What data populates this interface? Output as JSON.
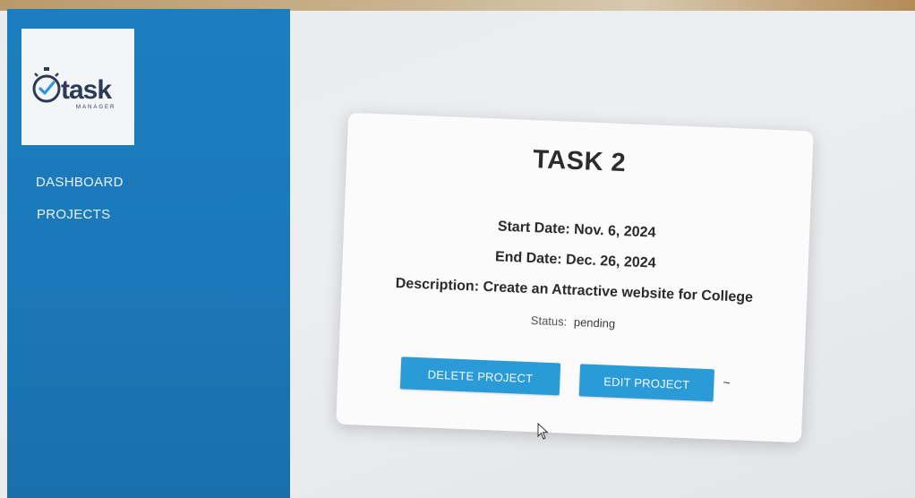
{
  "sidebar": {
    "logo": {
      "text": "task",
      "subtext": "MANAGER"
    },
    "items": [
      {
        "label": "DASHBOARD"
      },
      {
        "label": "PROJECTS"
      }
    ]
  },
  "task": {
    "title": "TASK 2",
    "start_date": "Start Date: Nov. 6, 2024",
    "end_date": "End Date: Dec. 26, 2024",
    "description": "Description: Create an Attractive website for College",
    "status_label": "Status:",
    "status_value": "pending"
  },
  "actions": {
    "delete_label": "DELETE PROJECT",
    "edit_label": "EDIT PROJECT",
    "trailing_text": "~"
  },
  "colors": {
    "sidebar": "#1c7ec0",
    "button": "#2a9bd7",
    "card": "#fbfbfc",
    "background": "#eceef1"
  },
  "icons": {
    "logo": "stopwatch-check-icon",
    "pointer": "mouse-cursor-icon"
  }
}
